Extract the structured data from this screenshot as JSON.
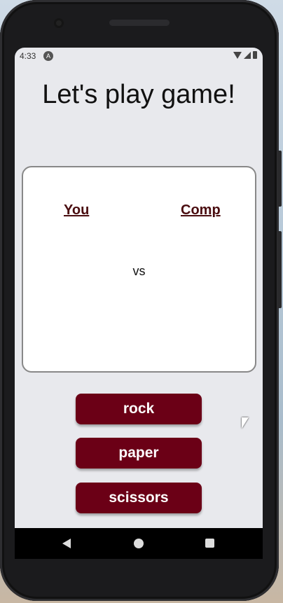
{
  "status_bar": {
    "time": "4:33",
    "app_icon_glyph": "A"
  },
  "app": {
    "title": "Let's play game!"
  },
  "board": {
    "player_label": "You",
    "computer_label": "Comp",
    "versus_text": "vs"
  },
  "choices": [
    {
      "label": "rock"
    },
    {
      "label": "paper"
    },
    {
      "label": "scissors"
    }
  ],
  "colors": {
    "accent": "#6b0016",
    "label_color": "#4a0d10",
    "screen_bg": "#e8e9ed"
  },
  "icons": {
    "nav": [
      "back-icon",
      "home-icon",
      "recents-icon"
    ],
    "status": [
      "wifi-icon",
      "signal-icon",
      "battery-icon"
    ]
  }
}
